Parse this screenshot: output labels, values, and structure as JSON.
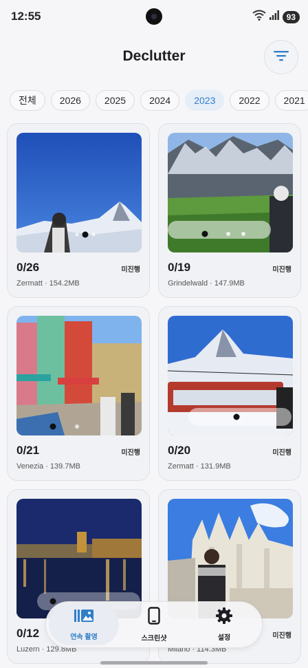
{
  "status_bar": {
    "time": "12:55",
    "battery": "93"
  },
  "header": {
    "title": "Declutter",
    "filter_icon": "filter-icon"
  },
  "year_filters": [
    "전체",
    "2026",
    "2025",
    "2024",
    "2023",
    "2022",
    "2021"
  ],
  "selected_year": "2023",
  "albums": [
    {
      "progress": "0/26",
      "status": "미진행",
      "meta": "Zermatt · 154.2MB"
    },
    {
      "progress": "0/19",
      "status": "미진행",
      "meta": "Grindelwald · 147.9MB"
    },
    {
      "progress": "0/21",
      "status": "미진행",
      "meta": "Venezia · 139.7MB"
    },
    {
      "progress": "0/20",
      "status": "미진행",
      "meta": "Zermatt · 131.9MB"
    },
    {
      "progress": "0/12",
      "status": "",
      "meta": "Luzern · 129.8MB"
    },
    {
      "progress": "",
      "status": "미진행",
      "meta": "Milano · 114.3MB"
    }
  ],
  "bottom_nav": [
    {
      "label": "연속 촬영",
      "icon": "burst-photos-icon",
      "active": true
    },
    {
      "label": "스크린샷",
      "icon": "phone-icon",
      "active": false
    },
    {
      "label": "설정",
      "icon": "gear-icon",
      "active": false
    }
  ],
  "colors": {
    "accent": "#2f7fc8",
    "background": "#f6f6f8",
    "card": "#f1f2f5"
  }
}
